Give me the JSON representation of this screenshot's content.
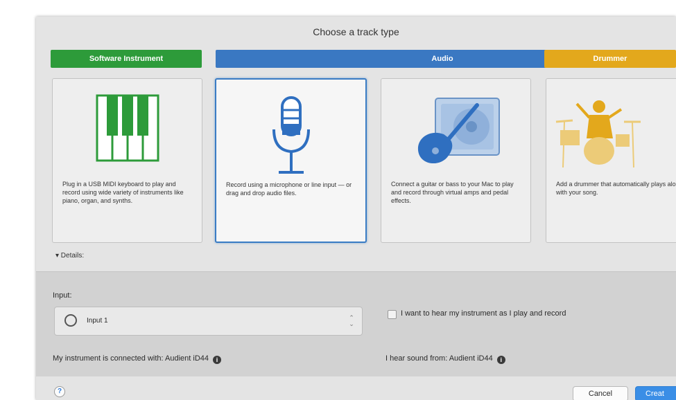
{
  "dialog": {
    "title": "Choose a track type"
  },
  "categories": [
    {
      "label": "Software Instrument",
      "color": "#2d9b3a"
    },
    {
      "label": "Audio",
      "color": "#3a78c2"
    },
    {
      "label": "Drummer",
      "color": "#e3a81c"
    }
  ],
  "cards": [
    {
      "icon": "piano-keyboard-icon",
      "description": "Plug in a USB MIDI keyboard to play and record using wide variety of instruments like piano, organ, and synths.",
      "selected": false
    },
    {
      "icon": "microphone-icon",
      "description": "Record using a microphone or line input — or drag and drop audio files.",
      "selected": true
    },
    {
      "icon": "guitar-amp-icon",
      "description": "Connect a guitar or bass to your Mac to play and record through virtual amps and pedal effects.",
      "selected": false
    },
    {
      "icon": "drummer-icon",
      "description": "Add a drummer that automatically plays along with your song.",
      "selected": false
    }
  ],
  "details": {
    "toggle_label": "▾ Details:"
  },
  "settings": {
    "input_label": "Input:",
    "input_value": "Input 1",
    "monitor_checkbox_label": "I want to hear my instrument as I play and record",
    "monitor_checked": false,
    "connected_label": "My instrument is connected with: Audient iD44",
    "output_label": "I hear sound from: Audient iD44"
  },
  "footer": {
    "help_label": "?",
    "cancel_label": "Cancel",
    "create_label": "Creat"
  },
  "colors": {
    "accent": "#3a8ee6",
    "selection_border": "#3a7cc4"
  }
}
